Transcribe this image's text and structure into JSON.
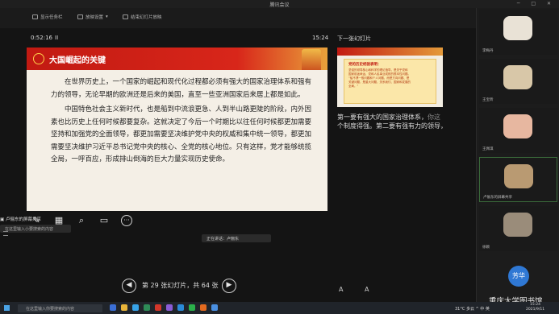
{
  "window": {
    "title": "腾讯会议",
    "controls": "─ □ ✕"
  },
  "toolbar": {
    "items": [
      "显示任务栏",
      "放映设置",
      "结束幻灯片放映"
    ]
  },
  "presenter": {
    "timer": "0:52:16",
    "pause_glyph": "II",
    "clock": "15:24",
    "next_label": "下一张幻灯片"
  },
  "slide": {
    "title": "大国崛起的关键",
    "paragraphs": [
      "在世界历史上，一个国家的崛起和现代化过程都必须有强大的国家治理体系和强有力的领导，无论早期的欧洲还是后来的美国，直至一些亚洲国家后来居上都是如此。",
      "中国特色社会主义新时代，也是船到中流浪更急、人到半山路更陡的阶段，内外因素也比历史上任何时候都要复杂。这就决定了今后一个时期比以往任何时候都更加需要坚持和加强党的全面领导，都更加需要坚决维护党中央的权威和集中统一领导，都更加需要坚决维护习近平总书记党中央的核心、全党的核心地位。只有这样，党才能够统揽全局，一呼百应，形成排山倒海的巨大力量实现历史使命。"
    ]
  },
  "tools": {
    "more_glyph": "···"
  },
  "speaker": {
    "label": "卢俪东的屏幕共享",
    "notes_placeholder": "在这里输入小要搜索的内容",
    "talking": "正在讲话：卢俪东"
  },
  "nav": {
    "prev": "◀",
    "next": "▶",
    "count": "第 29 张幻灯片，共 64 张"
  },
  "next_slide": {
    "box_title": "党的历史经验表明：",
    "box_lines": [
      "坚强的领导核心和科学的理论指导，是关乎党和",
      "国家前途命运、党和人民事业成败的根本性问题。",
      "“船不漂一般问题和个人问题，而是方向问题、是",
      "关键问题，是重大问题，关系我们、国家和发展的",
      "全局。”"
    ]
  },
  "notes": {
    "line1_a": "第一要有强大的国家治理体系，",
    "line1_b": "你这",
    "line2": "个制度得强。第二要有强有力的领导，"
  },
  "font_controls": "A A",
  "participants": [
    {
      "name": "李梅丹",
      "avatar_color": "#e9e2d6"
    },
    {
      "name": "王宝昕",
      "avatar_color": "#d8c7a8"
    },
    {
      "name": "王佩琪",
      "avatar_color": "#e7b7a0"
    },
    {
      "name": "卢俪东的屏幕共享",
      "avatar_color": "#b99a72"
    },
    {
      "name": "徐颖",
      "avatar_color": "#9a8c7a"
    },
    {
      "name": "",
      "initials": "芳华"
    }
  ],
  "watermark": "重庆大学图书馆",
  "taskbar": {
    "search_placeholder": "在这里输入你要搜索的内容",
    "app_colors": [
      "#3b6fd6",
      "#e8b43a",
      "#37a3e8",
      "#2e8b57",
      "#d3362a",
      "#8a5cd6",
      "#2a8bd8",
      "#2bb14b",
      "#e36a1f",
      "#4a90e2"
    ],
    "tray": "31°C 多云  ^  中  英",
    "time": "15:24",
    "date": "2021/9/11"
  }
}
